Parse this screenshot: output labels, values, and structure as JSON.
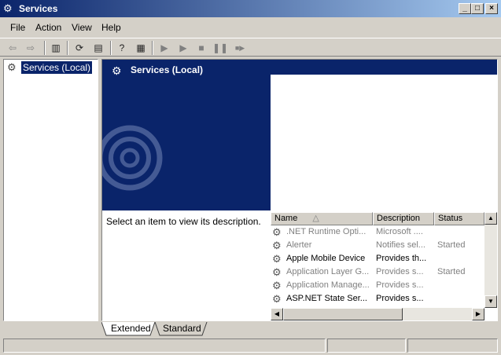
{
  "window": {
    "title": "Services",
    "icon": "gears-icon",
    "controls": {
      "minimize": "_",
      "maximize": "□",
      "close": "×"
    }
  },
  "menu": [
    "File",
    "Action",
    "View",
    "Help"
  ],
  "toolbar": {
    "buttons": [
      {
        "name": "back-icon",
        "glyph": "⇦",
        "dim": true
      },
      {
        "name": "forward-icon",
        "glyph": "⇨",
        "dim": true
      },
      {
        "name": "show-hide-tree-icon",
        "glyph": "▥",
        "dim": false
      },
      {
        "name": "refresh-icon",
        "glyph": "⟳",
        "dim": false
      },
      {
        "name": "export-list-icon",
        "glyph": "▤",
        "dim": false
      },
      {
        "name": "help-icon",
        "glyph": "?",
        "dim": false
      },
      {
        "name": "properties-icon",
        "glyph": "▦",
        "dim": false
      },
      {
        "name": "start-service-icon",
        "glyph": "▶",
        "dim": true
      },
      {
        "name": "start-service-alt-icon",
        "glyph": "▶",
        "dim": true
      },
      {
        "name": "stop-service-icon",
        "glyph": "■",
        "dim": true
      },
      {
        "name": "pause-service-icon",
        "glyph": "❚❚",
        "dim": true
      },
      {
        "name": "restart-service-icon",
        "glyph": "■▶",
        "dim": true
      }
    ]
  },
  "tree": {
    "item": "Services (Local)"
  },
  "pane": {
    "header_title": "Services (Local)",
    "description": "Select an item to view its description."
  },
  "list": {
    "columns": [
      "Name",
      "Description",
      "Status"
    ],
    "sort_indicator": "△",
    "rows": [
      {
        "name": ".NET Runtime Opti...",
        "description": "Microsoft ....",
        "status": "",
        "dim": true
      },
      {
        "name": "Alerter",
        "description": "Notifies sel...",
        "status": "Started",
        "dim": true
      },
      {
        "name": "Apple Mobile Device",
        "description": "Provides th...",
        "status": "",
        "dim": false
      },
      {
        "name": "Application Layer G...",
        "description": "Provides s...",
        "status": "Started",
        "dim": true
      },
      {
        "name": "Application Manage...",
        "description": "Provides s...",
        "status": "",
        "dim": true
      },
      {
        "name": "ASP.NET State Ser...",
        "description": "Provides s...",
        "status": "",
        "dim": false
      }
    ]
  },
  "tabs": [
    "Extended",
    "Standard"
  ],
  "colors": {
    "titlebar": "#0a246a",
    "selection": "#0a246a",
    "face": "#d4d0c8"
  }
}
